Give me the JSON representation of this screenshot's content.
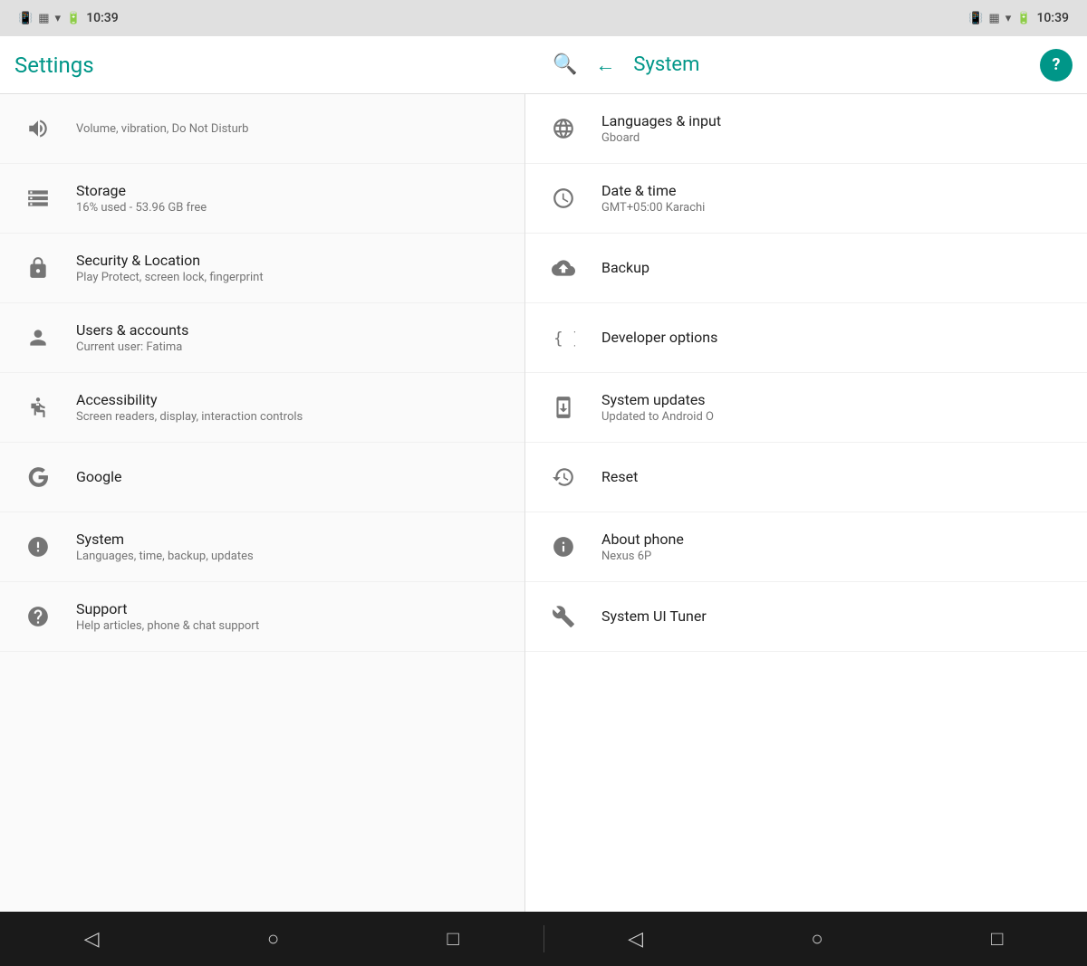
{
  "statusBar": {
    "left": {
      "time": "10:39"
    },
    "right": {
      "time": "10:39"
    }
  },
  "header": {
    "leftTitle": "Settings",
    "searchIcon": "🔍",
    "backIcon": "←",
    "rightTitle": "System",
    "helpIcon": "?"
  },
  "leftPanel": {
    "items": [
      {
        "id": "sound",
        "title": "",
        "subtitle": "Volume, vibration, Do Not Disturb",
        "icon": "sound"
      },
      {
        "id": "storage",
        "title": "Storage",
        "subtitle": "16% used - 53.96 GB free",
        "icon": "storage"
      },
      {
        "id": "security",
        "title": "Security & Location",
        "subtitle": "Play Protect, screen lock, fingerprint",
        "icon": "security"
      },
      {
        "id": "users",
        "title": "Users & accounts",
        "subtitle": "Current user: Fatima",
        "icon": "users"
      },
      {
        "id": "accessibility",
        "title": "Accessibility",
        "subtitle": "Screen readers, display, interaction controls",
        "icon": "accessibility"
      },
      {
        "id": "google",
        "title": "Google",
        "subtitle": "",
        "icon": "google"
      },
      {
        "id": "system",
        "title": "System",
        "subtitle": "Languages, time, backup, updates",
        "icon": "system"
      },
      {
        "id": "support",
        "title": "Support",
        "subtitle": "Help articles, phone & chat support",
        "icon": "support"
      }
    ]
  },
  "rightPanel": {
    "items": [
      {
        "id": "languages",
        "title": "Languages & input",
        "subtitle": "Gboard",
        "icon": "language"
      },
      {
        "id": "datetime",
        "title": "Date & time",
        "subtitle": "GMT+05:00 Karachi",
        "icon": "clock"
      },
      {
        "id": "backup",
        "title": "Backup",
        "subtitle": "",
        "icon": "backup"
      },
      {
        "id": "developer",
        "title": "Developer options",
        "subtitle": "",
        "icon": "developer"
      },
      {
        "id": "updates",
        "title": "System updates",
        "subtitle": "Updated to Android O",
        "icon": "update"
      },
      {
        "id": "reset",
        "title": "Reset",
        "subtitle": "",
        "icon": "reset"
      },
      {
        "id": "about",
        "title": "About phone",
        "subtitle": "Nexus 6P",
        "icon": "info"
      },
      {
        "id": "uituner",
        "title": "System UI Tuner",
        "subtitle": "",
        "icon": "wrench"
      }
    ]
  },
  "bottomNav": {
    "leftButtons": [
      "◁",
      "○",
      "□"
    ],
    "rightButtons": [
      "◁",
      "○",
      "□"
    ]
  }
}
